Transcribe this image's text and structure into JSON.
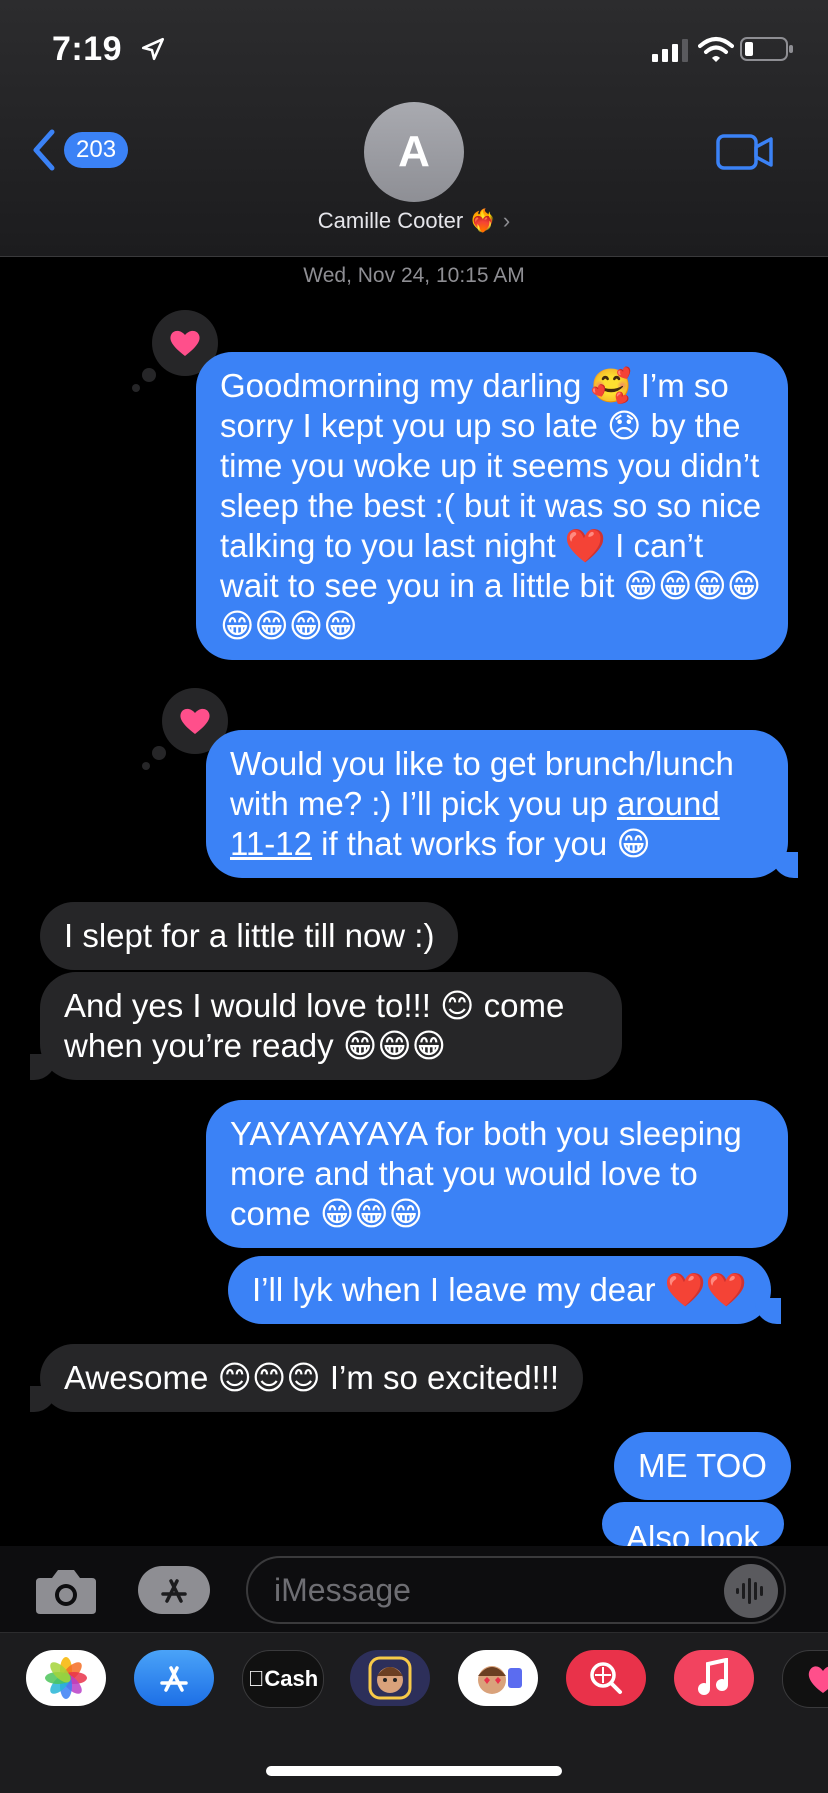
{
  "status_bar": {
    "time": "7:19"
  },
  "header": {
    "back_count": "203",
    "avatar_initial": "A",
    "contact_name": "Camille Cooter",
    "contact_emoji": "❤️‍🔥",
    "chevron": "›"
  },
  "thread": {
    "date": "Wed, Nov 24, 10:15 AM",
    "messages": [
      {
        "from": "me",
        "text": "Goodmorning my darling 🥰 I’m so sorry I kept you up so late 😞 by the time you woke up it seems you didn’t sleep the best :( but it was so so nice talking to you last night ❤️ I can’t wait to see you in a little bit 😁😁😁😁😁😁😁😁",
        "tapback": "heart"
      },
      {
        "from": "me",
        "text_a": "Would you like to get brunch/lunch with me? :) I’ll pick you up ",
        "text_link": "around 11-12",
        "text_b": " if that works for you 😁",
        "tapback": "heart"
      },
      {
        "from": "them",
        "text": "I slept for a little till now :)"
      },
      {
        "from": "them",
        "text": "And yes I would love to!!! 😊 come when you’re ready 😁😁😁"
      },
      {
        "from": "me",
        "text": "YAYAYAYAYA for both you sleeping more and that you would love to come 😁😁😁"
      },
      {
        "from": "me",
        "text": "I’ll lyk when I leave my dear ❤️❤️"
      },
      {
        "from": "them",
        "text": "Awesome 😊😊😊 I’m so excited!!!"
      },
      {
        "from": "me",
        "text": "ME TOO"
      },
      {
        "from": "me",
        "text": "Also look"
      }
    ]
  },
  "composer": {
    "placeholder": "iMessage"
  },
  "app_tray": {
    "items": [
      {
        "name": "Photos",
        "icon": "photos-icon"
      },
      {
        "name": "App Store",
        "icon": "appstore-icon"
      },
      {
        "name": "Cash",
        "label": "Cash",
        "icon": "apple-cash-icon"
      },
      {
        "name": "Memoji",
        "icon": "memoji-icon"
      },
      {
        "name": "Memoji Stickers",
        "icon": "memoji-stickers-icon"
      },
      {
        "name": "Search",
        "icon": "image-search-icon"
      },
      {
        "name": "Music",
        "icon": "music-icon"
      },
      {
        "name": "Digital Touch",
        "icon": "digital-touch-icon"
      }
    ]
  },
  "colors": {
    "sent": "#3b82f6",
    "received": "#262628",
    "tapback": "#ff4f8b",
    "accent": "#3b82f6"
  }
}
